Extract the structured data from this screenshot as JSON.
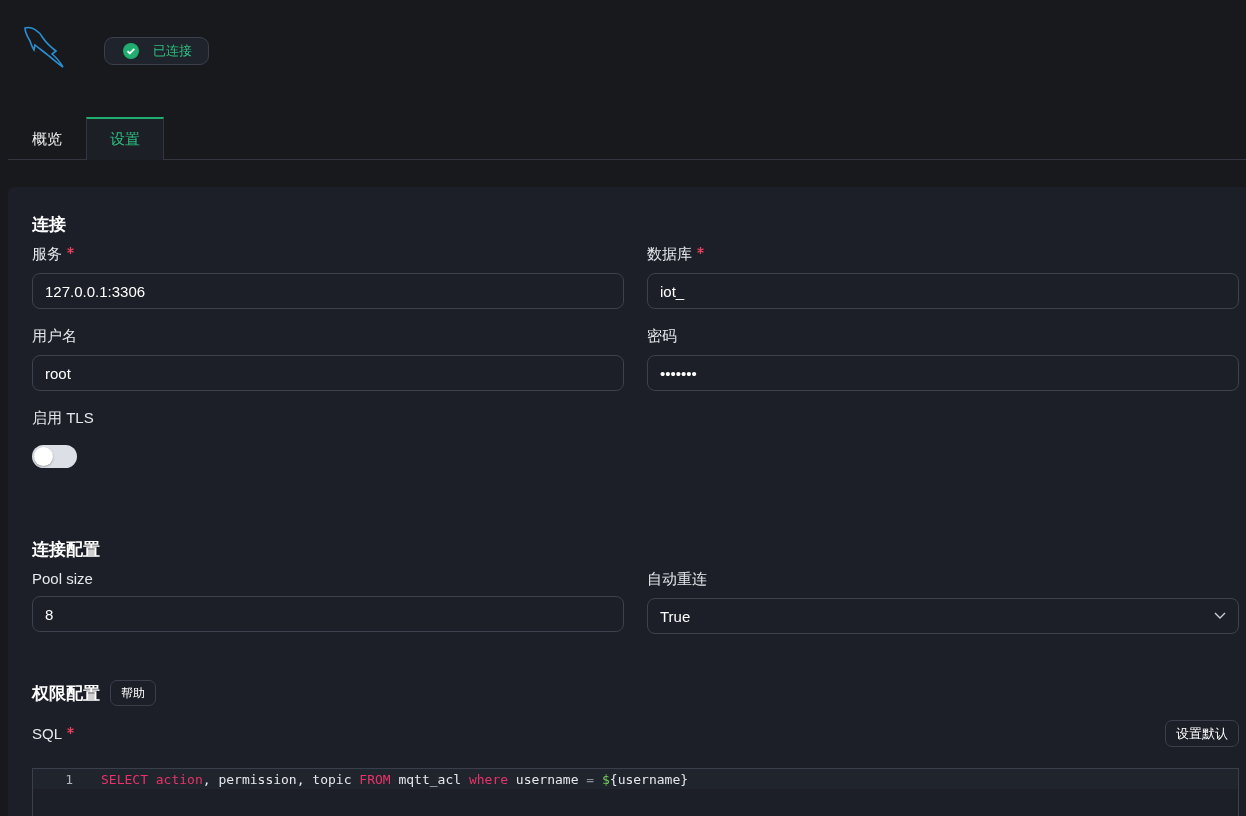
{
  "header": {
    "status": {
      "label": "已连接",
      "connected": true
    }
  },
  "tabs": [
    {
      "label": "概览",
      "selected": false
    },
    {
      "label": "设置",
      "selected": true
    }
  ],
  "sections": [
    {
      "title": "连接",
      "fields": [
        {
          "kind": "input",
          "label": "服务",
          "required": true,
          "value": "127.0.0.1:3306"
        },
        {
          "kind": "input",
          "label": "数据库",
          "required": true,
          "value": "iot_"
        },
        {
          "kind": "input",
          "label": "用户名",
          "value": "root"
        },
        {
          "kind": "password",
          "label": "密码",
          "value": "•••••••"
        },
        {
          "kind": "switch",
          "label": "启用 TLS",
          "on": false
        }
      ]
    },
    {
      "title": "连接配置",
      "fields": [
        {
          "kind": "input",
          "label": "Pool size",
          "value": "8"
        },
        {
          "kind": "select",
          "label": "自动重连",
          "value": "True"
        }
      ]
    },
    {
      "title": "权限配置",
      "help": "帮助",
      "sql": {
        "label": "SQL",
        "required": true,
        "default_button": "设置默认",
        "lines": [
          {
            "number": "1",
            "tokens": [
              {
                "kind": "keyword",
                "text": "SELECT"
              },
              {
                "kind": "keyword",
                "text": " action"
              },
              {
                "kind": "plain",
                "text": ", permission, topic "
              },
              {
                "kind": "keyword",
                "text": "FROM"
              },
              {
                "kind": "plain",
                "text": " mqtt_acl "
              },
              {
                "kind": "keyword",
                "text": "where"
              },
              {
                "kind": "plain",
                "text": " username "
              },
              {
                "kind": "operator",
                "text": "= "
              },
              {
                "kind": "variable",
                "text": "$"
              },
              {
                "kind": "plain",
                "text": "{username}"
              }
            ]
          }
        ]
      }
    }
  ]
}
